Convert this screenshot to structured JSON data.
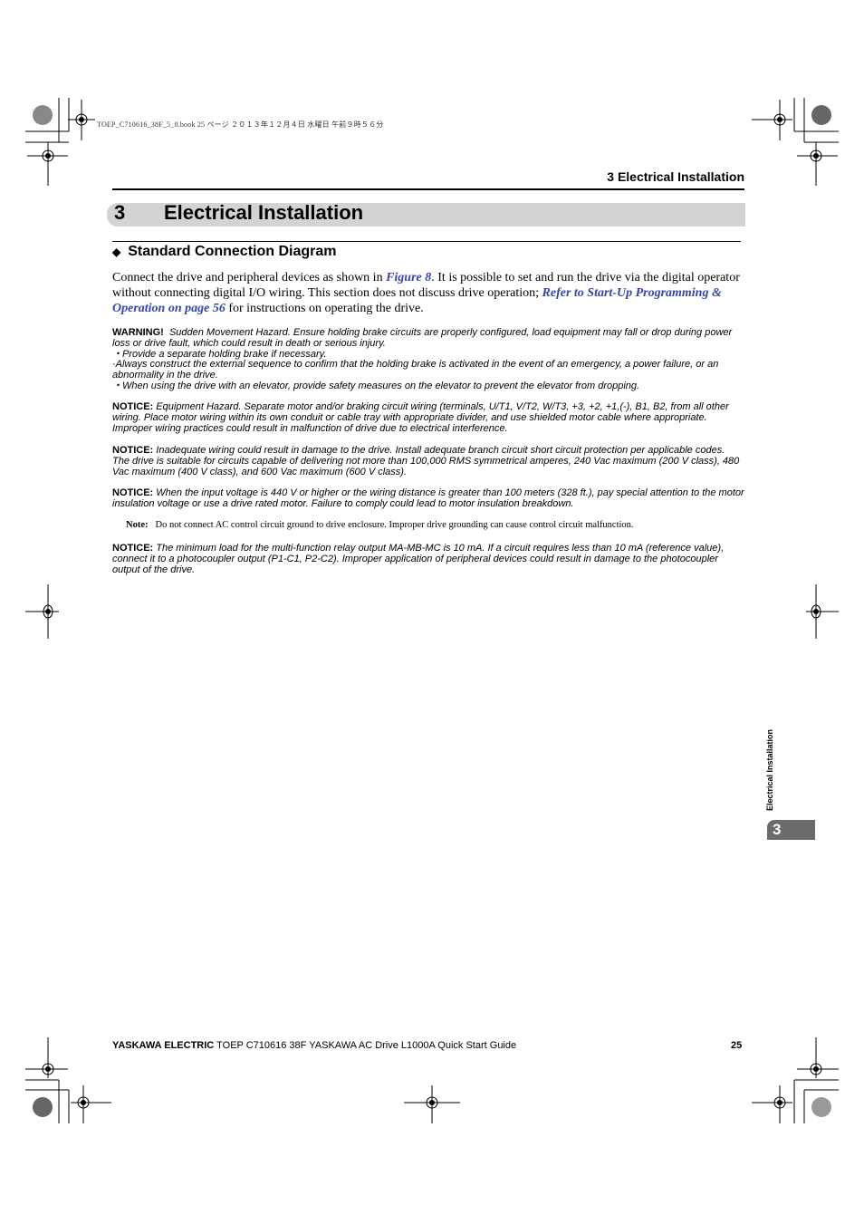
{
  "slug": "TOEP_C710616_38F_5_0.book  25 ページ  ２０１３年１２月４日  水曜日  午前９時５６分",
  "running_header": "3  Electrical Installation",
  "chapter": {
    "number": "3",
    "title": "Electrical Installation"
  },
  "section": {
    "icon": "diamond-bullet-icon",
    "title": "Standard Connection Diagram"
  },
  "intro": {
    "t1": "Connect the drive and peripheral devices as shown in ",
    "link1": "Figure 8",
    "t2": ". It is possible to set and run the drive via the digital operator without connecting digital I/O wiring. This section does not discuss drive operation; ",
    "link2": "Refer to Start-Up Programming & Operation on page 56",
    "t3": " for instructions on operating the drive."
  },
  "warning": {
    "label": "WARNING!",
    "text": "Sudden Movement Hazard. Ensure holding brake circuits are properly configured, load equipment may fall or drop during power loss or drive fault, which could result in death or serious injury.",
    "bullets": [
      "・Provide a separate holding brake if necessary.",
      "·Always construct the external sequence to confirm that the holding brake is activated in the event of an emergency, a power failure, or an abnormality in the drive.",
      "・When using the drive with an elevator, provide safety measures on the elevator to prevent the elevator from dropping."
    ]
  },
  "notices": [
    {
      "label": "NOTICE:",
      "text": "Equipment Hazard. Separate motor and/or braking circuit wiring (terminals, U/T1, V/T2, W/T3, +3, +2, +1,(-), B1, B2, from all other wiring. Place motor wiring within its own conduit or cable tray with appropriate divider, and use shielded motor cable where appropriate. Improper wiring practices could result in malfunction of drive due to electrical interference."
    },
    {
      "label": "NOTICE:",
      "text": "Inadequate wiring could result in damage to the drive. Install adequate branch circuit short circuit protection per applicable codes. The drive is suitable for circuits capable of delivering not more than 100,000 RMS symmetrical amperes, 240 Vac maximum (200 V class), 480 Vac maximum (400 V class), and 600 Vac maximum (600 V class)."
    },
    {
      "label": "NOTICE:",
      "text": "When the input voltage is 440 V or higher or the wiring distance is greater than 100 meters (328 ft.), pay special attention to the motor insulation voltage or use a drive rated motor. Failure to comply could lead to motor insulation breakdown."
    },
    {
      "label": "NOTICE:",
      "text": "The minimum load for the multi-function relay output MA-MB-MC is 10 mA. If a circuit requires less than 10 mA (reference value), connect it to a photocoupler output (P1-C1, P2-C2). Improper application of peripheral devices could result in damage to the photocoupler output of the drive."
    }
  ],
  "note": {
    "label": "Note:",
    "text": "Do not connect AC control circuit ground to drive enclosure. Improper drive grounding can cause control circuit malfunction."
  },
  "footer": {
    "brand": "YASKAWA ELECTRIC",
    "doc": " TOEP C710616 38F YASKAWA AC Drive L1000A Quick Start Guide",
    "page": "25"
  },
  "side_tab": {
    "label": "Electrical Installation",
    "number": "3"
  }
}
